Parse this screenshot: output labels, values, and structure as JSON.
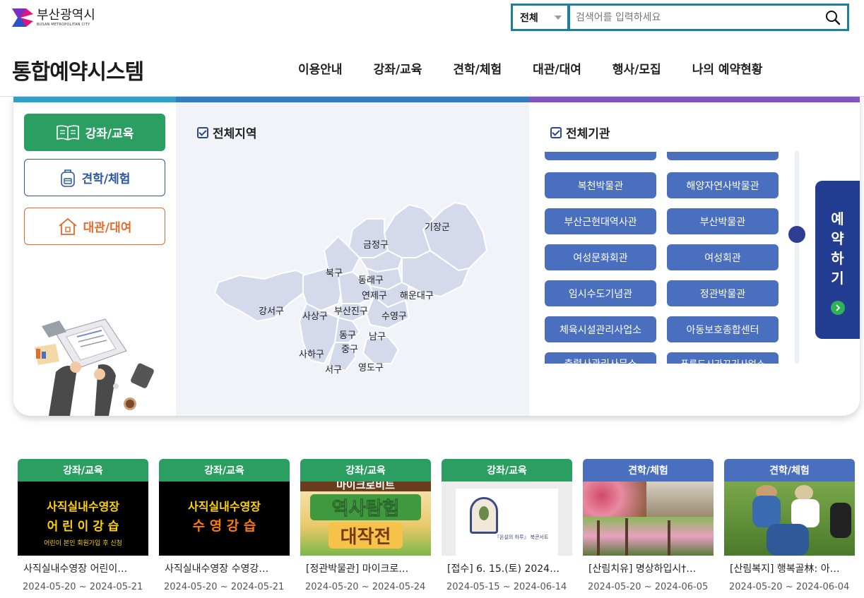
{
  "brand": {
    "name_ko": "부산광역시",
    "name_en": "BUSAN METROPOLITAN CITY"
  },
  "search": {
    "scope": "전체",
    "placeholder": "검색어를 입력하세요"
  },
  "site_title": "통합예약시스템",
  "nav": [
    "이용안내",
    "강좌/교육",
    "견학/체험",
    "대관/대여",
    "행사/모집",
    "나의 예약현황"
  ],
  "categories": [
    {
      "label": "강좌/교육",
      "icon": "book-icon",
      "color": "#2b9e62"
    },
    {
      "label": "견학/체험",
      "icon": "backpack-icon",
      "color": "#2c5aa0"
    },
    {
      "label": "대관/대여",
      "icon": "house-icon",
      "color": "#e46a2c"
    }
  ],
  "region": {
    "title": "전체지역",
    "districts": [
      "기장군",
      "금정구",
      "북구",
      "동래구",
      "연제구",
      "해운대구",
      "강서구",
      "사상구",
      "부산진구",
      "수영구",
      "동구",
      "남구",
      "사하구",
      "중구",
      "서구",
      "영도구"
    ]
  },
  "institutions": {
    "title": "전체기관",
    "items": [
      "복천박물관",
      "해양자연사박물관",
      "부산근현대역사관",
      "부산박물관",
      "여성문화회관",
      "여성회관",
      "임시수도기념관",
      "정관박물관",
      "체육시설관리사업소",
      "아동보호종합센터",
      "충렬사관리사무소",
      "푸른도시가꾸기사업소"
    ]
  },
  "reserve": {
    "label": "예약하기"
  },
  "programs": [
    {
      "tag": "강좌/교육",
      "title": "사직실내수영장 어린이…",
      "date": "2024-05-20 ~ 2024-05-21",
      "img_line1": "사직실내수영장",
      "img_line2": "어 린 이  강 습",
      "img_line3": "어린이 본인 회원가입 후 신청"
    },
    {
      "tag": "강좌/교육",
      "title": "사직실내수영장 수영강…",
      "date": "2024-05-20 ~ 2024-05-21",
      "img_line1": "사직실내수영장",
      "img_line2": "수 영 강 습"
    },
    {
      "tag": "강좌/교육",
      "title": "[정관박물관] 마이크로…",
      "date": "2024-05-20 ~ 2024-05-24",
      "img_line1": "마이크로비트",
      "img_line2": "역사탐험",
      "img_line3": "대작전"
    },
    {
      "tag": "강좌/교육",
      "title": "[접수] 6. 15.(토) 2024…",
      "date": "2024-05-15 ~ 2024-06-14",
      "img_line1": "『온설의 하루』 북콘서트"
    },
    {
      "tag": "견학/체험",
      "title": "[산림치유] 명상하입시†…",
      "date": "2024-05-20 ~ 2024-06-05"
    },
    {
      "tag": "견학/체험",
      "title": "[산림복지] 행복골林: 아…",
      "date": "2024-05-20 ~ 2024-06-04"
    }
  ],
  "colors": {
    "edu": "#2b9e62",
    "exp": "#4a6fbf",
    "rental": "#e46a2c",
    "primary": "#213c91",
    "search_border": "#1a7fa4"
  }
}
